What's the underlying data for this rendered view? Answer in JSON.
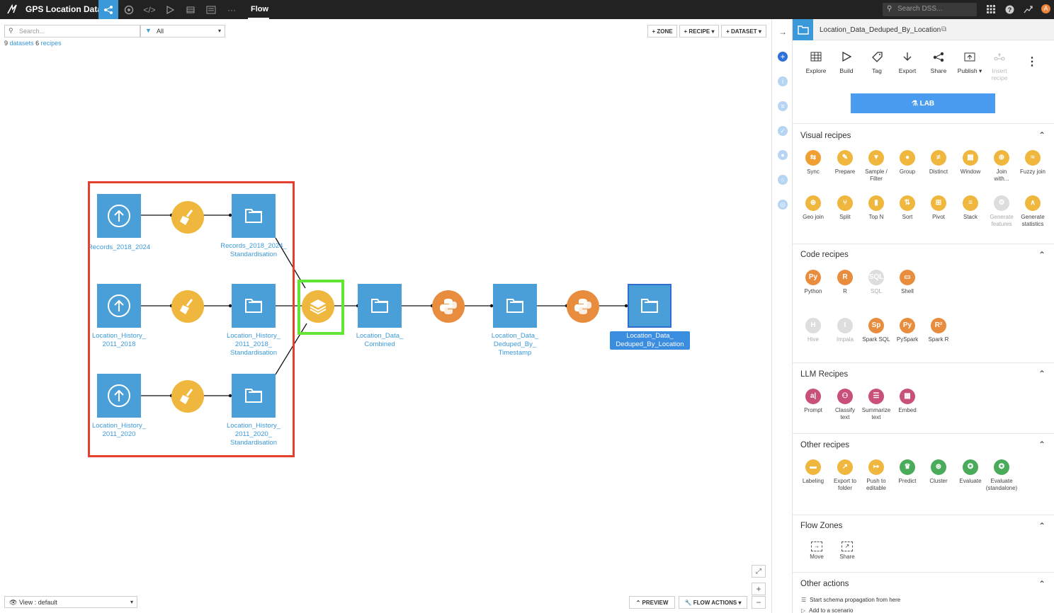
{
  "topbar": {
    "project_name": "GPS Location Data",
    "current_view": "Flow",
    "search_placeholder": "Search DSS...",
    "avatar_initial": "A"
  },
  "canvas": {
    "search_placeholder": "Search...",
    "filter_value": "All",
    "datasets_count": "9",
    "datasets_label": "datasets",
    "recipes_count": "6",
    "recipes_label": "recipes",
    "btn_zone": "+ ZONE",
    "btn_recipe": "+ RECIPE",
    "btn_dataset": "+ DATASET",
    "view_select": "View : default",
    "btn_preview": "PREVIEW",
    "btn_flow_actions": "FLOW ACTIONS"
  },
  "flow": {
    "nodes": {
      "upload1": "Records_2018_2024",
      "std1": "Records_2018_2024_\nStandardisation",
      "upload2": "Location_History_\n2011_2018",
      "std2": "Location_History_\n2011_2018_\nStandardisation",
      "upload3": "Location_History_\n2011_2020",
      "std3": "Location_History_\n2011_2020_\nStandardisation",
      "combined": "Location_Data_\nCombined",
      "deduped_ts": "Location_Data_\nDeduped_By_\nTimestamp",
      "deduped_loc": "Location_Data_\nDeduped_By_Location"
    }
  },
  "panel": {
    "title": "Location_Data_Deduped_By_Location",
    "actions": [
      {
        "label": "Explore",
        "icon": "table-icon"
      },
      {
        "label": "Build",
        "icon": "play-icon"
      },
      {
        "label": "Tag",
        "icon": "tag-icon"
      },
      {
        "label": "Export",
        "icon": "download-icon"
      },
      {
        "label": "Share",
        "icon": "share-icon"
      },
      {
        "label": "Publish ▾",
        "icon": "publish-icon"
      },
      {
        "label": "Insert\nrecipe",
        "icon": "insert-icon"
      }
    ],
    "lab_label": "LAB",
    "visual_recipes": {
      "title": "Visual recipes",
      "items": [
        "Sync",
        "Prepare",
        "Sample /\nFilter",
        "Group",
        "Distinct",
        "Window",
        "Join\nwith...",
        "Fuzzy join",
        "Geo join",
        "Split",
        "Top N",
        "Sort",
        "Pivot",
        "Stack",
        "Generate\nfeatures",
        "Generate\nstatistics"
      ]
    },
    "code_recipes": {
      "title": "Code recipes",
      "items": [
        "Python",
        "R",
        "SQL",
        "Shell",
        "Hive",
        "Impala",
        "Spark SQL",
        "PySpark",
        "Spark R"
      ]
    },
    "llm_recipes": {
      "title": "LLM Recipes",
      "items": [
        "Prompt",
        "Classify\ntext",
        "Summarize\ntext",
        "Embed"
      ]
    },
    "other_recipes": {
      "title": "Other recipes",
      "items": [
        "Labeling",
        "Export to\nfolder",
        "Push to\neditable",
        "Predict",
        "Cluster",
        "Evaluate",
        "Evaluate\n(standalone)"
      ]
    },
    "flow_zones": {
      "title": "Flow Zones",
      "items": [
        "Move",
        "Share"
      ]
    },
    "other_actions": {
      "title": "Other actions",
      "items": [
        "Start schema propagation from here",
        "Add to a scenario"
      ]
    }
  },
  "colors": {
    "dataset_blue": "#4a9fd8",
    "prepare_yellow": "#f0b73e",
    "python_orange": "#e88d3e",
    "red_highlight": "#e43f2f",
    "green_highlight": "#62e534",
    "lab_blue": "#4a9cf0"
  }
}
